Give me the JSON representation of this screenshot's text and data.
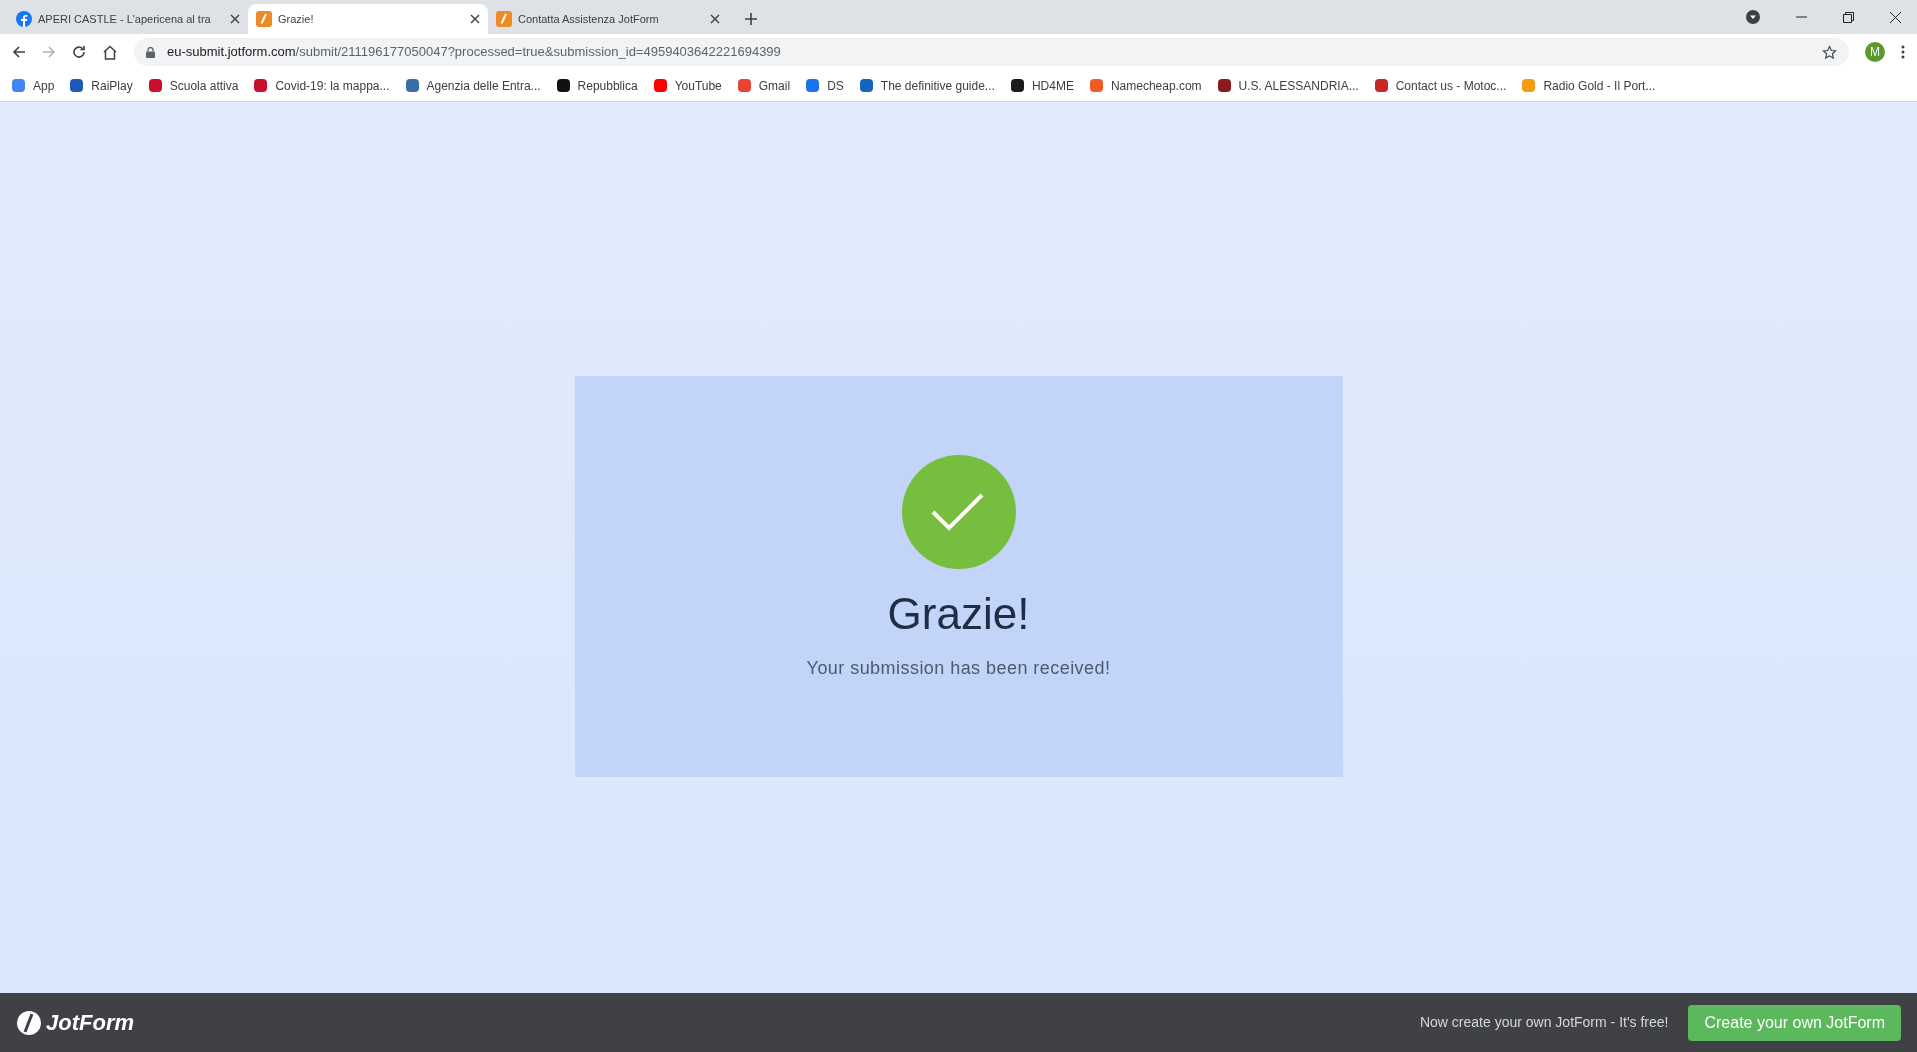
{
  "tabs": [
    {
      "title": "APERI CASTLE - L'apericena al tra",
      "kind": "facebook",
      "selected": false
    },
    {
      "title": "Grazie!",
      "kind": "jotform",
      "selected": true
    },
    {
      "title": "Contatta Assistenza JotForm",
      "kind": "jotform",
      "selected": false
    }
  ],
  "address_bar": {
    "host": "eu-submit.jotform.com",
    "path": "/submit/211196177050047?processed=true&submission_id=4959403642221694399"
  },
  "profile": {
    "initial": "M"
  },
  "bookmarks": [
    {
      "label": "App",
      "color": "#4285f4"
    },
    {
      "label": "RaiPlay",
      "color": "#1e5bb8"
    },
    {
      "label": "Scuola attiva",
      "color": "#c8102e"
    },
    {
      "label": "Covid-19: la mappa...",
      "color": "#c8102e"
    },
    {
      "label": "Agenzia delle Entra...",
      "color": "#3a6ea5"
    },
    {
      "label": "Repubblica",
      "color": "#111111"
    },
    {
      "label": "YouTube",
      "color": "#ff0000"
    },
    {
      "label": "Gmail",
      "color": "#ea4335"
    },
    {
      "label": "DS",
      "color": "#1a73e8"
    },
    {
      "label": "The definitive guide...",
      "color": "#1565c0"
    },
    {
      "label": "HD4ME",
      "color": "#1a1a1a"
    },
    {
      "label": "Namecheap.com",
      "color": "#f15a24"
    },
    {
      "label": "U.S. ALESSANDRIA...",
      "color": "#8b1a1a"
    },
    {
      "label": "Contact us - Motoc...",
      "color": "#c62828"
    },
    {
      "label": "Radio Gold - Il Port...",
      "color": "#f39c12"
    }
  ],
  "card": {
    "title": "Grazie!",
    "message": "Your submission has been received!"
  },
  "footer": {
    "brand": "JotForm",
    "tagline": "Now create your own JotForm - It's free!",
    "button": "Create your own JotForm"
  }
}
